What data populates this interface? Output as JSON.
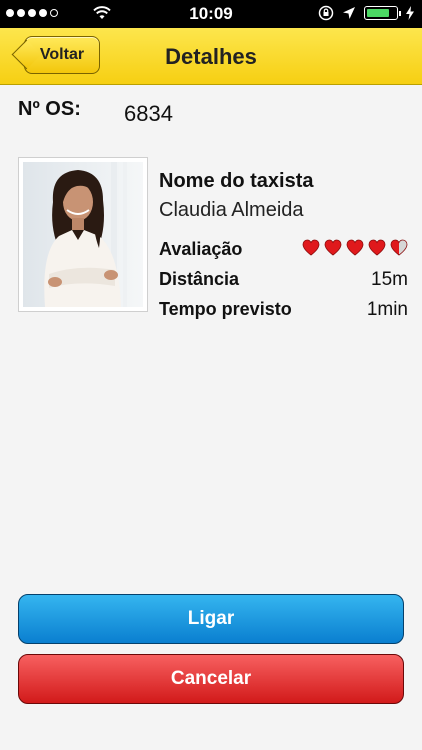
{
  "status_bar": {
    "time": "10:09",
    "signal_bars_filled": 4,
    "signal_bars_total": 5,
    "battery_level": 0.7,
    "battery_color": "#4cd964"
  },
  "nav": {
    "back_label": "Voltar",
    "title": "Detalhes",
    "bar_color": "#f6cf12"
  },
  "order": {
    "label": "Nº OS:",
    "value": "6834"
  },
  "driver": {
    "name_label": "Nome do taxista",
    "name": "Claudia Almeida",
    "rating_label": "Avaliação",
    "rating": 4.5,
    "rating_max": 5,
    "rating_color": "#e0191c",
    "distance_label": "Distância",
    "distance": "15m",
    "eta_label": "Tempo previsto",
    "eta": "1min"
  },
  "actions": {
    "call_label": "Ligar",
    "cancel_label": "Cancelar",
    "call_color": "#0a7fd0",
    "cancel_color": "#d21a1a"
  }
}
